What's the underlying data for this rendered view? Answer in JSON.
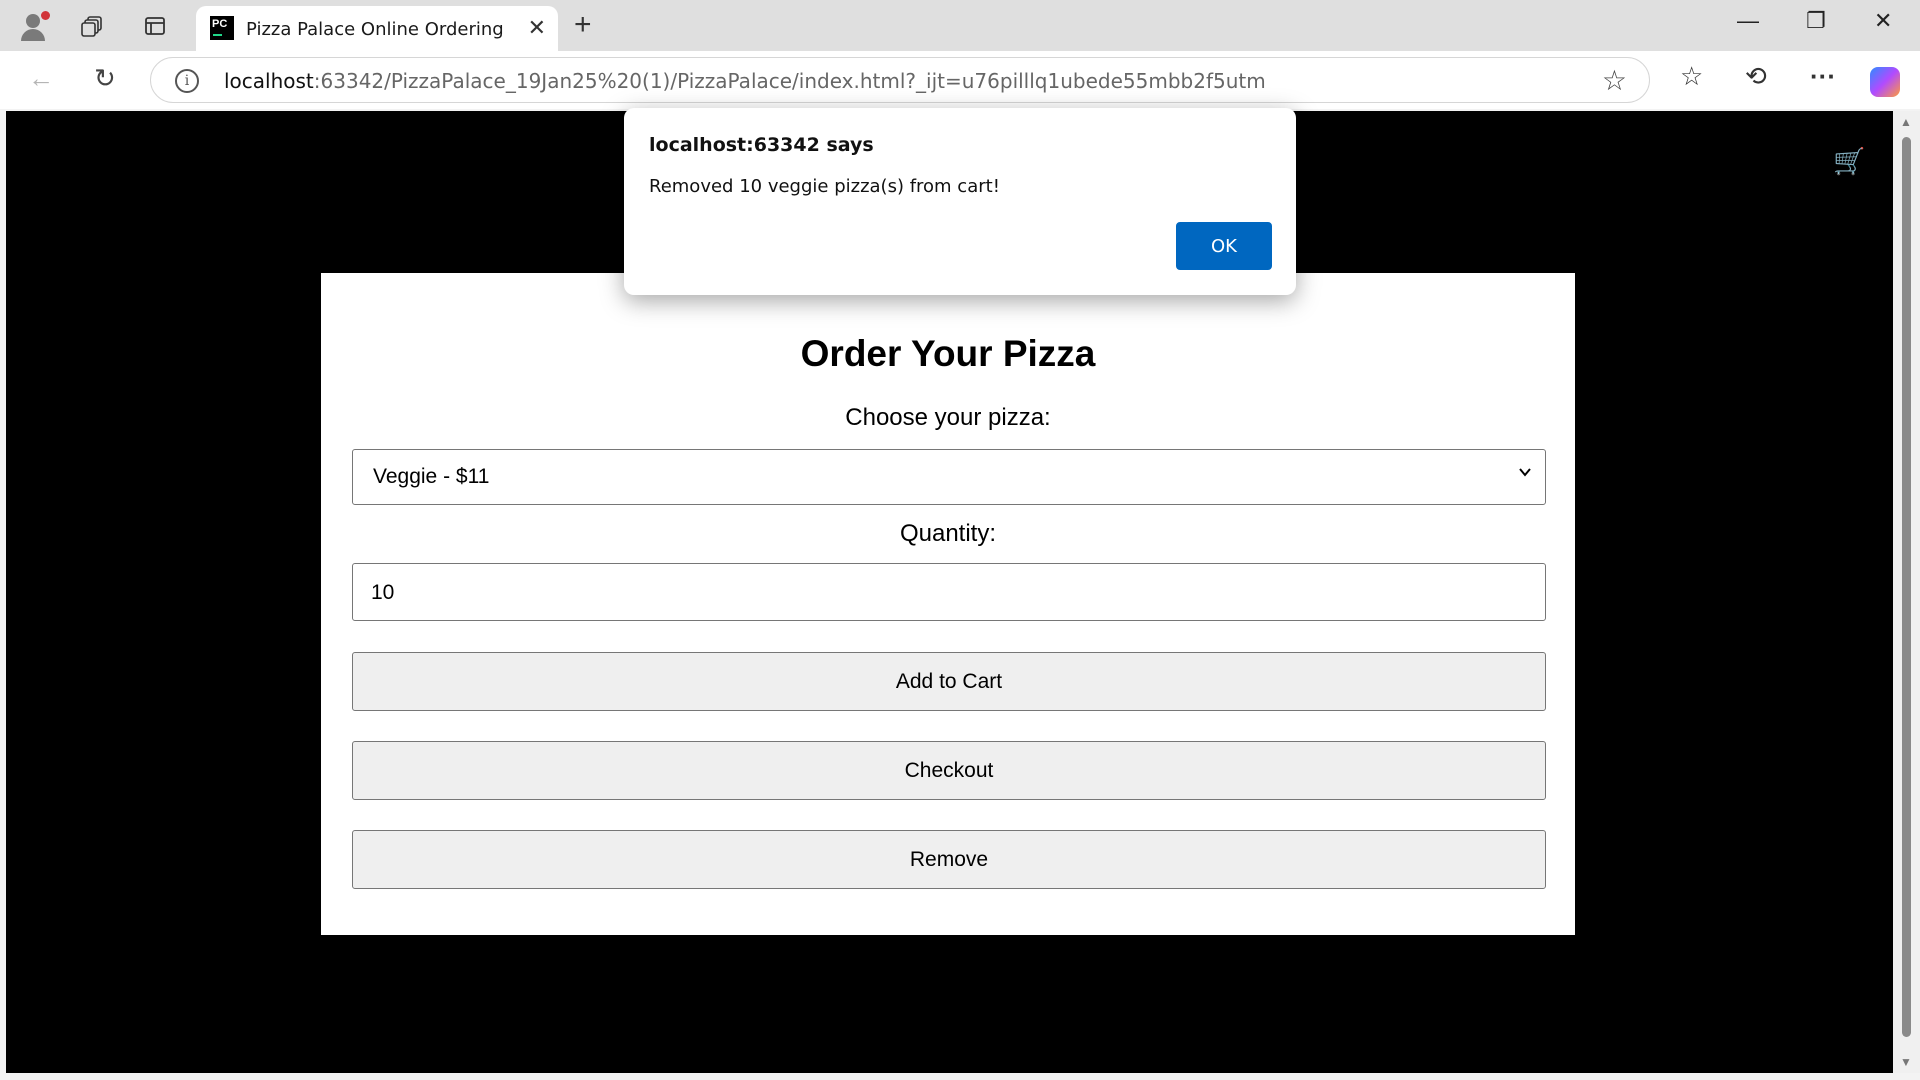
{
  "browser": {
    "tab_title": "Pizza Palace Online Ordering",
    "tab_favicon": "PC",
    "url_host": "localhost",
    "url_rest": ":63342/PizzaPalace_19Jan25%20(1)/PizzaPalace/index.html?_ijt=u76pilllq1ubede55mbb2f5utm",
    "icons": {
      "new_tab": "+",
      "close_tab": "✕",
      "minimize": "—",
      "restore": "❐",
      "close_window": "✕",
      "back": "←",
      "reload": "↻",
      "info": "i",
      "star": "☆",
      "favorites": "☆",
      "history": "⟲",
      "more": "···"
    }
  },
  "page": {
    "cart_icon": "🛒",
    "title": "Order Your Pizza",
    "choose_label": "Choose your pizza:",
    "selected_pizza": "Veggie - $11",
    "quantity_label": "Quantity:",
    "quantity_value": "10",
    "add_to_cart": "Add to Cart",
    "checkout": "Checkout",
    "remove": "Remove"
  },
  "dialog": {
    "title": "localhost:63342 says",
    "message": "Removed 10 veggie pizza(s) from cart!",
    "ok": "OK"
  }
}
